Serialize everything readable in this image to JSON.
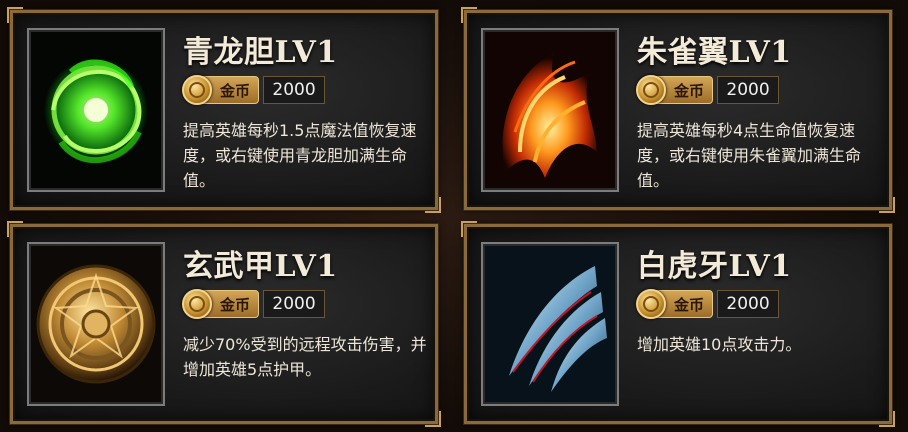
{
  "currency_label": "金币",
  "cards": [
    {
      "title": "青龙胆LV1",
      "icon": "green-dragon-orb-icon",
      "price": "2000",
      "description": "提高英雄每秒1.5点魔法值恢复速度，或右键使用青龙胆加满生命值。"
    },
    {
      "title": "朱雀翼LV1",
      "icon": "phoenix-wing-icon",
      "price": "2000",
      "description": "提高英雄每秒4点生命值恢复速度，或右键使用朱雀翼加满生命值。"
    },
    {
      "title": "玄武甲LV1",
      "icon": "golden-shield-icon",
      "price": "2000",
      "description": "减少70%受到的远程攻击伤害，并增加英雄5点护甲。"
    },
    {
      "title": "白虎牙LV1",
      "icon": "tiger-claw-icon",
      "price": "2000",
      "description": "增加英雄10点攻击力。"
    }
  ],
  "colors": {
    "frame_gold": "#8a6a3a",
    "coin_gold": "#d3a556",
    "card_bg": "#1a1a1a"
  }
}
